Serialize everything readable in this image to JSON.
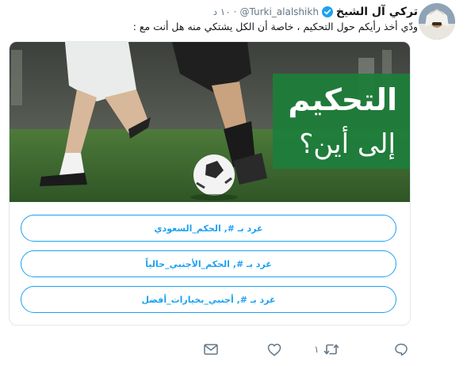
{
  "tweet": {
    "display_name": "تركي آل الشيخ",
    "handle": "@Turki_alalshikh",
    "separator": "·",
    "time": "١٠ د",
    "text": "ودّي أخذ رأيكم حول التحكيم ، خاصة أن الكل يشتكي منه هل أنت مع :"
  },
  "card": {
    "image_title": "التحكيم",
    "image_subtitle": "إلى أين؟",
    "options": [
      "غرد بـ #, الحكم_السعودي",
      "غرد بـ #, الحكم_الأجنبي_حالياً",
      "غرد بـ #, أجنبي_بخيارات_أفضل"
    ]
  },
  "actions": {
    "reply_count": "",
    "retweet_count": "١",
    "like_count": ""
  },
  "colors": {
    "accent": "#1da1f2",
    "secondary_text": "#657786",
    "image_green": "#1e7d3a",
    "border": "#e1e8ed"
  },
  "icons": {
    "verified": "verified-badge-icon",
    "reply": "reply-icon",
    "retweet": "retweet-icon",
    "like": "heart-icon",
    "dm": "mail-icon"
  }
}
